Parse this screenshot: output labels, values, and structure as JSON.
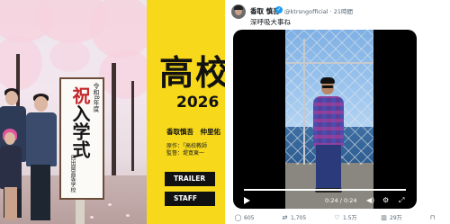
{
  "poster": {
    "sign": {
      "date": "令和8年度",
      "celebrate": "祝",
      "title_rest": "入学式",
      "school": "目出岡高等学校"
    },
    "yellow_panel": {
      "title": "高校",
      "year": "2026",
      "cast": "香取慎吾　仲里佑",
      "original": "原作：「高校教師",
      "director": "監督：堤寛東一",
      "trailer_label": "TRAILER",
      "staff_label": "STAFF",
      "background_color": "#f7d81b"
    }
  },
  "tweet": {
    "author_name": "香取 慎吾",
    "handle": "@ktrsngofficial",
    "timestamp": "21時間",
    "body": "深呼吸大事ね",
    "video": {
      "elapsed": "0:24",
      "duration": "0:24",
      "progress": 1.0
    },
    "actions": {
      "replies": "605",
      "retweets": "1,705",
      "likes": "1.5万",
      "views": "29万"
    }
  }
}
